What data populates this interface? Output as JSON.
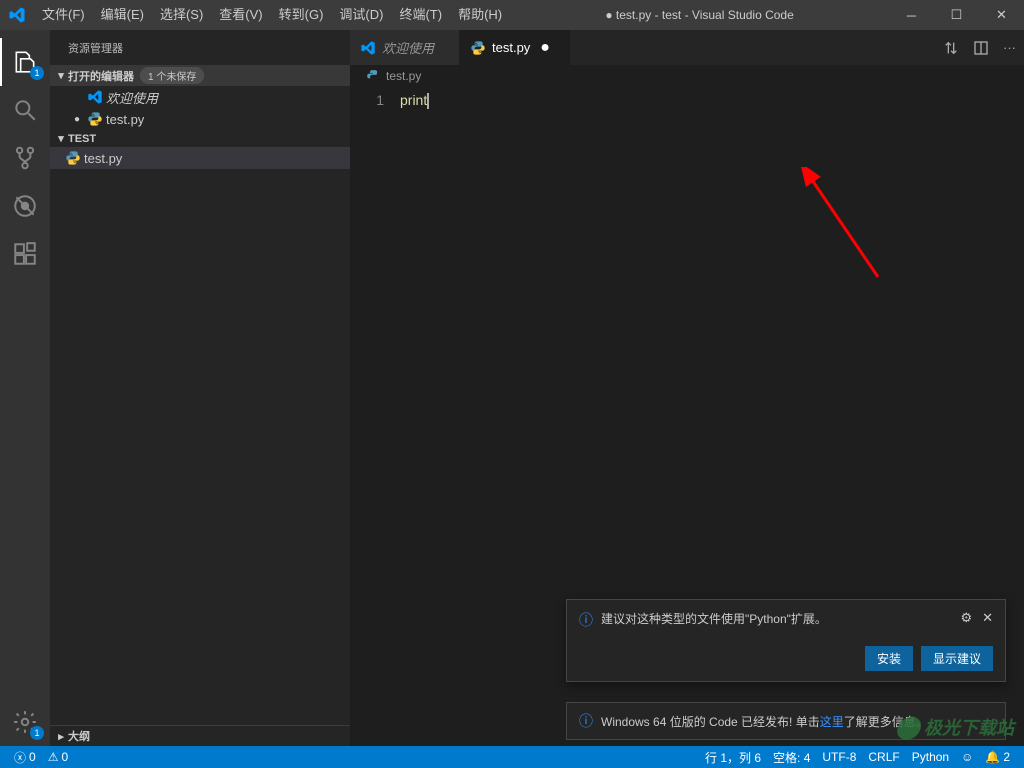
{
  "colors": {
    "accent": "#007acc",
    "link": "#3794ff"
  },
  "titlebar": {
    "menus": [
      "文件(F)",
      "编辑(E)",
      "选择(S)",
      "查看(V)",
      "转到(G)",
      "调试(D)",
      "终端(T)",
      "帮助(H)"
    ],
    "title": "● test.py - test - Visual Studio Code"
  },
  "activitybar": {
    "explorer_badge": "1",
    "settings_badge": "1"
  },
  "sidebar": {
    "title": "资源管理器",
    "open_editors": {
      "label": "打开的编辑器",
      "badge": "1 个未保存"
    },
    "items_open": [
      {
        "label": "欢迎使用",
        "icon": "vscode",
        "dirty": false
      },
      {
        "label": "test.py",
        "icon": "python",
        "dirty": true
      }
    ],
    "folder": {
      "label": "TEST"
    },
    "items_folder": [
      {
        "label": "test.py",
        "icon": "python"
      }
    ],
    "outline": {
      "label": "大纲"
    }
  },
  "tabs": [
    {
      "label": "欢迎使用",
      "icon": "vscode",
      "dirty": false,
      "active": false
    },
    {
      "label": "test.py",
      "icon": "python",
      "dirty": true,
      "active": true
    }
  ],
  "breadcrumb": "test.py",
  "editor": {
    "line_number": "1",
    "code": "print"
  },
  "notification1": {
    "message_prefix": "建议对这种类型的文件使用\"",
    "message_highlight": "Python",
    "message_suffix": "\"扩展。",
    "btn_install": "安装",
    "btn_show": "显示建议"
  },
  "notification2": {
    "prefix": "Windows 64 位版的 Code 已经发布! 单击",
    "link": "这里",
    "suffix": "了解更多信息。"
  },
  "statusbar": {
    "errors": "0",
    "warnings": "0",
    "cursor": "行 1，列 6",
    "spaces": "空格: 4",
    "encoding": "UTF-8",
    "eol": "CRLF",
    "language": "Python",
    "feedback": "☺",
    "bell_count": "2"
  },
  "watermark": "极光下载站"
}
